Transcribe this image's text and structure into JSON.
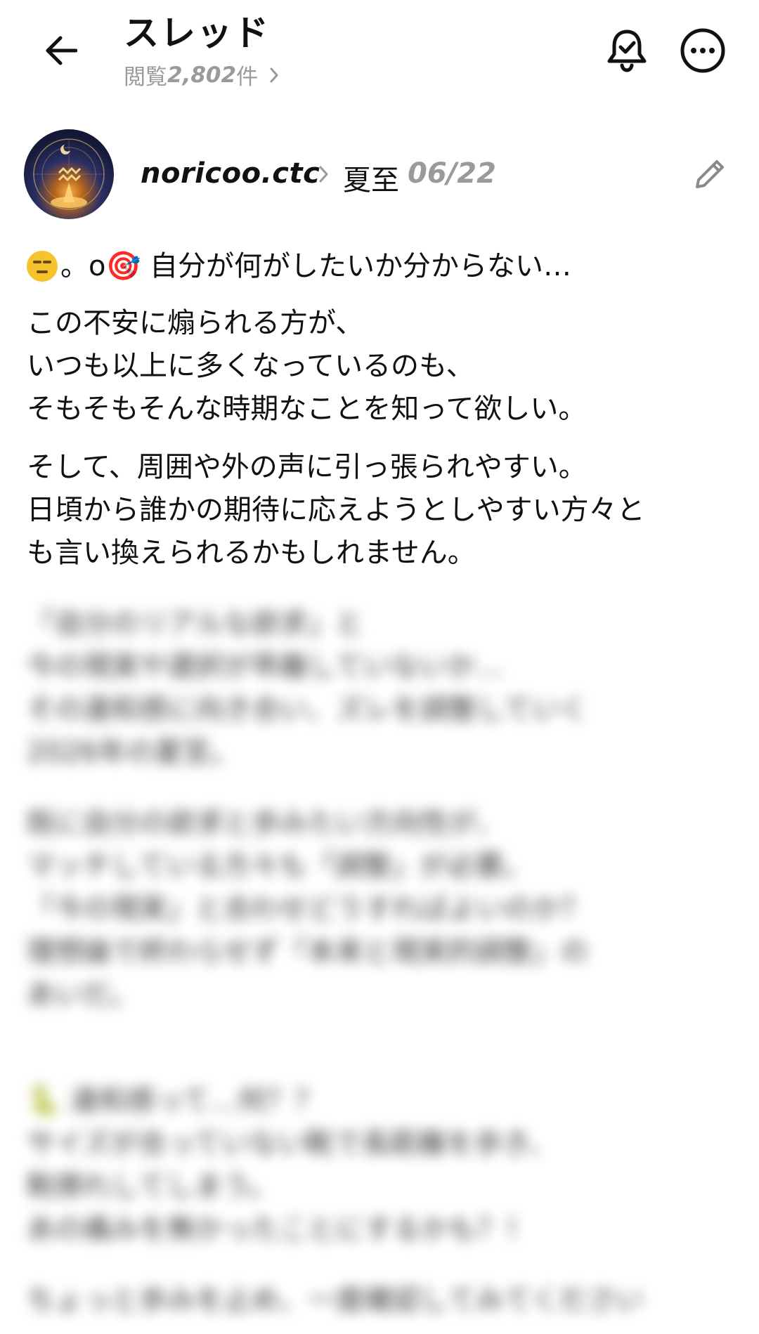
{
  "header": {
    "title": "スレッド",
    "views_prefix": "閲覧",
    "views_count": "2,802",
    "views_suffix": "件"
  },
  "icons": {
    "back": "arrow-left-icon",
    "bell": "bell-check-icon",
    "more": "more-horizontal-icon",
    "edit": "pencil-icon",
    "chevron": "chevron-right-icon"
  },
  "author": {
    "name": "noricoo.ctc",
    "tag": "夏至",
    "date": "06/22"
  },
  "post": {
    "first_line_suffix": "。o🎯 自分が何がしたいか分からない…",
    "paragraphs": [
      "この不安に煽られる方が、\nいつも以上に多くなっているのも、\nそもそもそんな時期なことを知って欲しい。",
      "そして、周囲や外の声に引っ張られやすい。\n日頃から誰かの期待に応えようとしやすい方々と\nも言い換えられるかもしれません。"
    ],
    "blurred_paragraphs": [
      "「自分のリアルな欲求」と\n今の現実や選択が乖離していないか…\nその違和感に向き合い、ズレを調整していく\n2026年の夏至。",
      "既に自分の欲求と歩みたい方向性が、\nマッチしている方々も「調整」が必要。\n「今の現実」と合わせどうすればよいのか？\n理想論で終わらせず「本来と現実的調整」の\nあいだ。",
      "🐍 違和感って…何？？\nサイズが合っていない靴で長距離を歩き、\n靴擦れしてしまう。\nあの痛みを無かったことにするかも？！",
      "ちょっと歩みを止め、一度確認してみてください"
    ]
  }
}
